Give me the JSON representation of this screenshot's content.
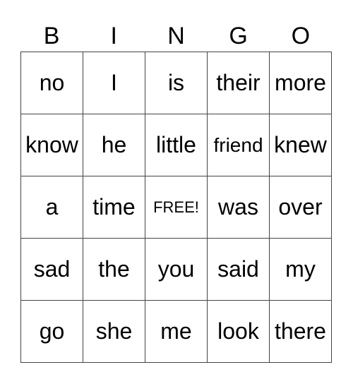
{
  "header": [
    "B",
    "I",
    "N",
    "G",
    "O"
  ],
  "rows": [
    [
      "no",
      "I",
      "is",
      "their",
      "more"
    ],
    [
      "know",
      "he",
      "little",
      "friend",
      "knew"
    ],
    [
      "a",
      "time",
      "FREE!",
      "was",
      "over"
    ],
    [
      "sad",
      "the",
      "you",
      "said",
      "my"
    ],
    [
      "go",
      "she",
      "me",
      "look",
      "there"
    ]
  ]
}
